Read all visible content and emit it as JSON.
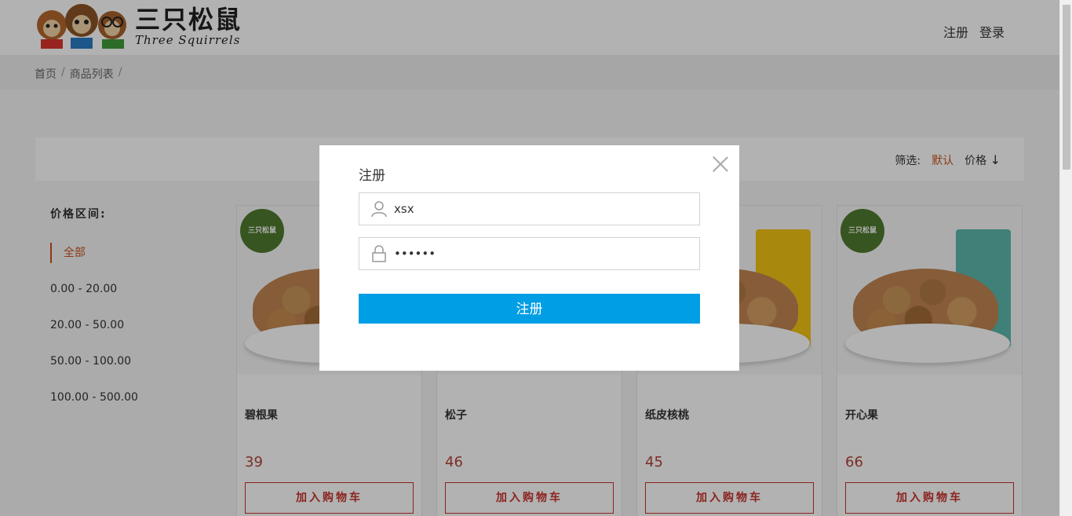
{
  "header": {
    "logo_cn": "三只松鼠",
    "logo_en": "Three Squirrels",
    "register_link": "注册",
    "login_link": "登录"
  },
  "breadcrumb": {
    "items": [
      "首页",
      "商品列表"
    ],
    "separator": "/"
  },
  "filter": {
    "label": "筛选:",
    "default": "默认",
    "price": "价格",
    "price_arrow": "↓"
  },
  "price_ranges": {
    "title": "价格区间:",
    "items": [
      "全部",
      "0.00 - 20.00",
      "20.00 - 50.00",
      "50.00 - 100.00",
      "100.00 - 500.00"
    ]
  },
  "products": [
    {
      "name": "碧根果",
      "price": "39",
      "cart_label": "加入购物车"
    },
    {
      "name": "松子",
      "price": "46",
      "cart_label": "加入购物车"
    },
    {
      "name": "纸皮核桃",
      "price": "45",
      "cart_label": "加入购物车"
    },
    {
      "name": "开心果",
      "price": "66",
      "cart_label": "加入购物车"
    }
  ],
  "modal": {
    "title": "注册",
    "username_value": "xsx",
    "password_value": "••••••",
    "submit_label": "注册"
  },
  "colors": {
    "accent_orange": "#c8541c",
    "price_red": "#b0423a",
    "button_blue": "#009ee5"
  }
}
